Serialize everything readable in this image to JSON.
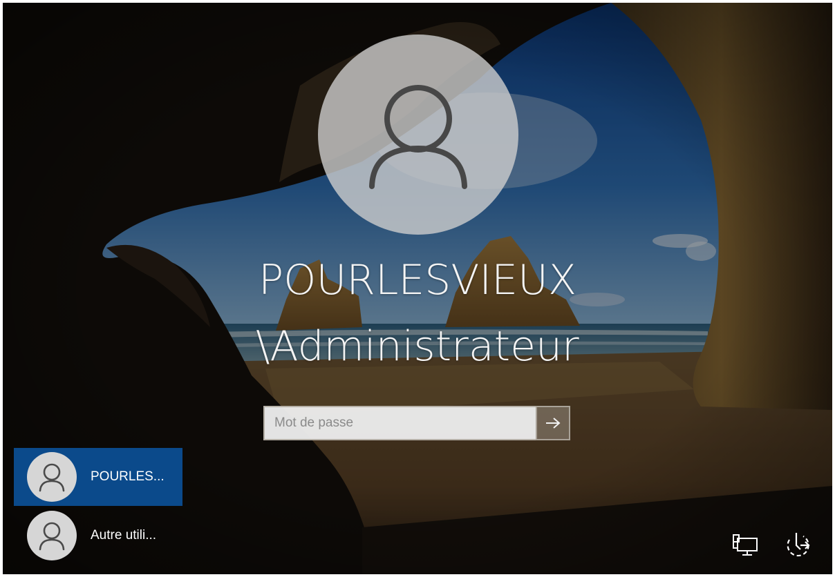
{
  "user": {
    "name_line1": "POURLESVIEUX",
    "name_line2": "\\Administrateur"
  },
  "password": {
    "placeholder": "Mot de passe"
  },
  "user_list": [
    {
      "label": "POURLES...",
      "selected": true
    },
    {
      "label": "Autre utili...",
      "selected": false
    }
  ],
  "icons": {
    "avatar": "user-icon",
    "submit": "arrow-right-icon",
    "network": "network-icon",
    "ease_of_access": "ease-of-access-icon"
  },
  "colors": {
    "selected_tile": "#0b4a8b",
    "avatar_bg": "#cdcdcd",
    "text": "#f4f4f4"
  }
}
